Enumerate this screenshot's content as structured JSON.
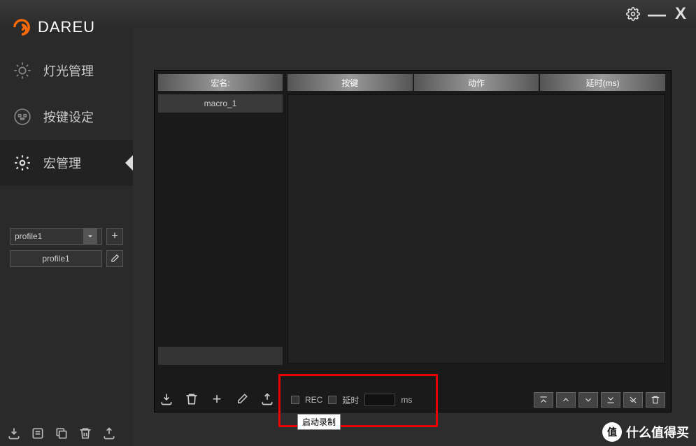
{
  "logo": {
    "text": "DAREU"
  },
  "nav": {
    "lighting": "灯光管理",
    "keys": "按键设定",
    "macro": "宏管理"
  },
  "profile": {
    "selected": "profile1",
    "name": "profile1"
  },
  "panel": {
    "macro_name_header": "宏名:",
    "macro_list": [
      "macro_1"
    ],
    "columns": {
      "key": "按键",
      "action": "动作",
      "delay": "延时(ms)"
    }
  },
  "rec": {
    "rec_label": "REC",
    "delay_label": "延时",
    "ms_label": "ms"
  },
  "tooltip": "启动录制",
  "watermark": {
    "badge": "值",
    "text": "什么值得买"
  }
}
